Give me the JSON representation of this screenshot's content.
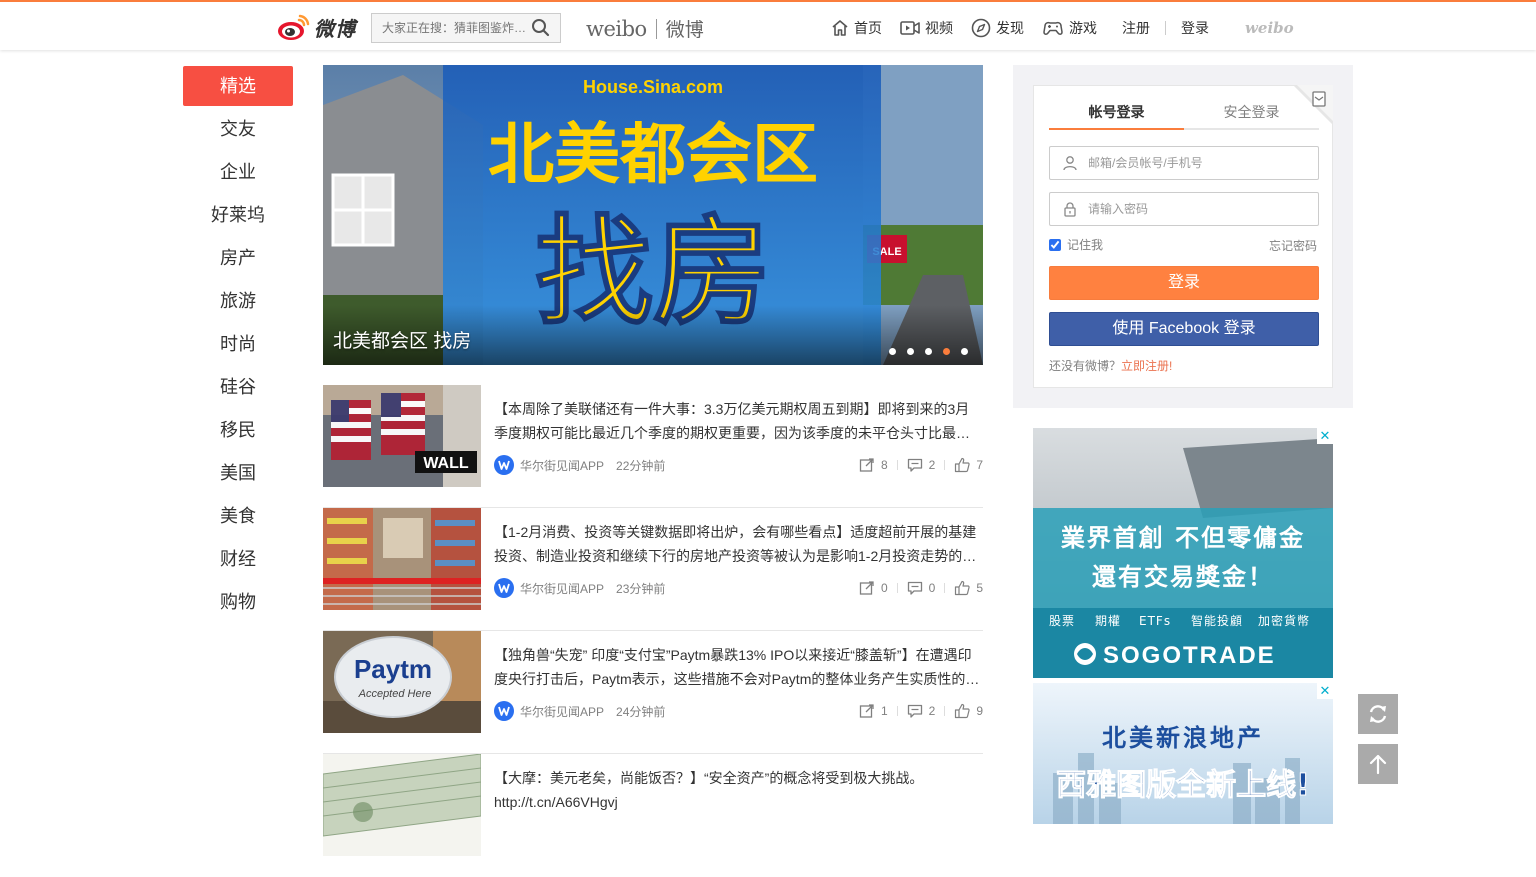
{
  "header": {
    "logo_text": "微博",
    "search_placeholder": "大家正在搜：猜菲图鉴炸…",
    "brand_en": "weibo",
    "brand_cn": "微博",
    "nav": [
      {
        "label": "首页",
        "icon": "home-icon"
      },
      {
        "label": "视频",
        "icon": "video-icon"
      },
      {
        "label": "发现",
        "icon": "discover-icon"
      },
      {
        "label": "游戏",
        "icon": "game-icon"
      }
    ],
    "register_label": "注册",
    "login_label": "登录",
    "small_logo": "weibo"
  },
  "sidebar": {
    "items": [
      {
        "label": "精选",
        "active": true
      },
      {
        "label": "交友"
      },
      {
        "label": "企业"
      },
      {
        "label": "好莱坞"
      },
      {
        "label": "房产"
      },
      {
        "label": "旅游"
      },
      {
        "label": "时尚"
      },
      {
        "label": "硅谷"
      },
      {
        "label": "移民"
      },
      {
        "label": "美国"
      },
      {
        "label": "美食"
      },
      {
        "label": "财经"
      },
      {
        "label": "购物"
      }
    ]
  },
  "carousel": {
    "site_label": "House.Sina.com",
    "headline_top": "北美都会区",
    "headline_big": "找房",
    "sign_label": "SALE",
    "caption": "北美都会区 找房",
    "dots": 5,
    "active_dot": 3
  },
  "feed": [
    {
      "text": "【本周除了美联储还有一件大事：3.3万亿美元期权周五到期】即将到来的3月季度期权可能比最近几个季度的期权更重要，因为该季度的未平仓头寸比最…",
      "source": "华尔街见闻APP",
      "time": "22分钟前",
      "reposts": "8",
      "comments": "2",
      "likes": "7",
      "thumb": "wall-street",
      "thumb_text": "WALL"
    },
    {
      "text": "【1-2月消费、投资等关键数据即将出炉，会有哪些看点】适度超前开展的基建投资、制造业投资和继续下行的房地产投资等被认为是影响1-2月投资走势的…",
      "source": "华尔街见闻APP",
      "time": "23分钟前",
      "reposts": "0",
      "comments": "0",
      "likes": "5",
      "thumb": "supermarket",
      "thumb_text": ""
    },
    {
      "text": "【独角兽“失宠” 印度“支付宝”Paytm暴跌13% IPO以来接近“膝盖斩”】在遭遇印度央行打击后，Paytm表示，这些措施不会对Paytm的整体业务产生实质性的…",
      "source": "华尔街见闻APP",
      "time": "24分钟前",
      "reposts": "1",
      "comments": "2",
      "likes": "9",
      "thumb": "paytm",
      "thumb_text": "Paytm",
      "thumb_subtext": "Accepted Here"
    },
    {
      "text": "【大摩：美元老矣，尚能饭否？】“安全资产”的概念将受到极大挑战。 http://t.cn/A66VHgvj",
      "source": "",
      "time": "",
      "reposts": "",
      "comments": "",
      "likes": "",
      "thumb": "dollars",
      "thumb_text": ""
    }
  ],
  "login": {
    "tab_account": "帐号登录",
    "tab_secure": "安全登录",
    "username_placeholder": "邮箱/会员帐号/手机号",
    "password_placeholder": "请输入密码",
    "remember_label": "记住我",
    "forgot_label": "忘记密码",
    "login_button": "登录",
    "facebook_button": "使用 Facebook 登录",
    "no_account": "还没有微博？",
    "register_link": "立即注册!"
  },
  "ads": [
    {
      "line1": "業界首創 不但零傭金",
      "line2": "還有交易獎金！",
      "tags": [
        "股票",
        "期權",
        "ETFs",
        "智能投顧",
        "加密貨幣"
      ],
      "brand": "SOGOTRADE",
      "close": "✕"
    },
    {
      "line1": "北美新浪地产",
      "line2": "西雅图版全新上线!",
      "close": "✕"
    }
  ],
  "colors": {
    "accent": "#fa7d3c",
    "active_red": "#f74f42",
    "facebook": "#3f5fa8",
    "link_orange": "#eb7350"
  }
}
